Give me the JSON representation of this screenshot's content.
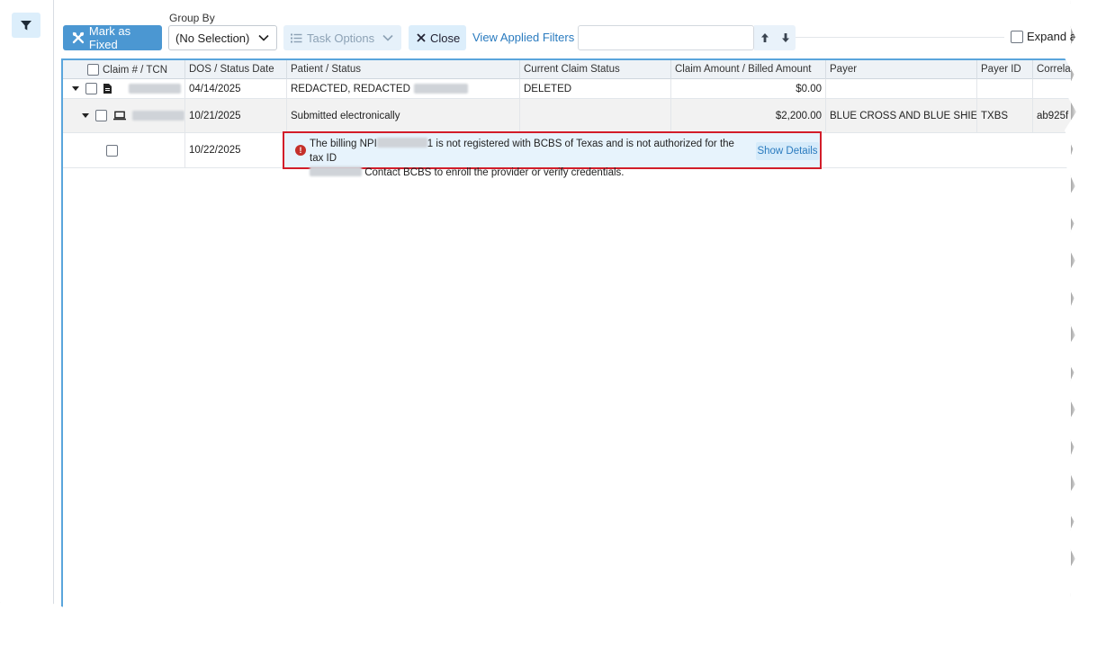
{
  "toolbar": {
    "mark_fixed_label": "Mark as Fixed",
    "group_by_label": "Group By",
    "group_by_value": "(No Selection)",
    "task_options_label": "Task Options",
    "close_label": "Close",
    "view_filters_label": "View Applied Filters",
    "search_value": "",
    "expand_label": "Expand a"
  },
  "grid": {
    "columns": [
      "Claim # / TCN",
      "DOS / Status Date",
      "Patient / Status",
      "Current Claim Status",
      "Claim Amount / Billed Amount",
      "Payer",
      "Payer ID",
      "Correla"
    ],
    "rows": [
      {
        "dos": "04/14/2025",
        "patient": "REDACTED, REDACTED",
        "status": "DELETED",
        "amount": "$0.00",
        "payer": "",
        "payer_id": "",
        "correlation": ""
      },
      {
        "dos": "10/21/2025",
        "patient": "Submitted electronically",
        "status": "",
        "amount": "$2,200.00",
        "payer": "BLUE CROSS AND BLUE SHIEL…",
        "payer_id": "TXBS",
        "correlation": "ab925f"
      },
      {
        "dos": "10/22/2025"
      }
    ],
    "error": {
      "line1_a": "The billing NPI",
      "line1_b": "1 is not registered with BCBS of Texas and is not authorized for the tax ID",
      "line2": "Contact BCBS to enroll the provider or verify credentials.",
      "show_details_label": "Show Details"
    }
  },
  "colors": {
    "primary": "#4b97d2",
    "link": "#2a7bbf",
    "error_border": "#d21d2a",
    "grid_border": "#5aa5dc"
  }
}
